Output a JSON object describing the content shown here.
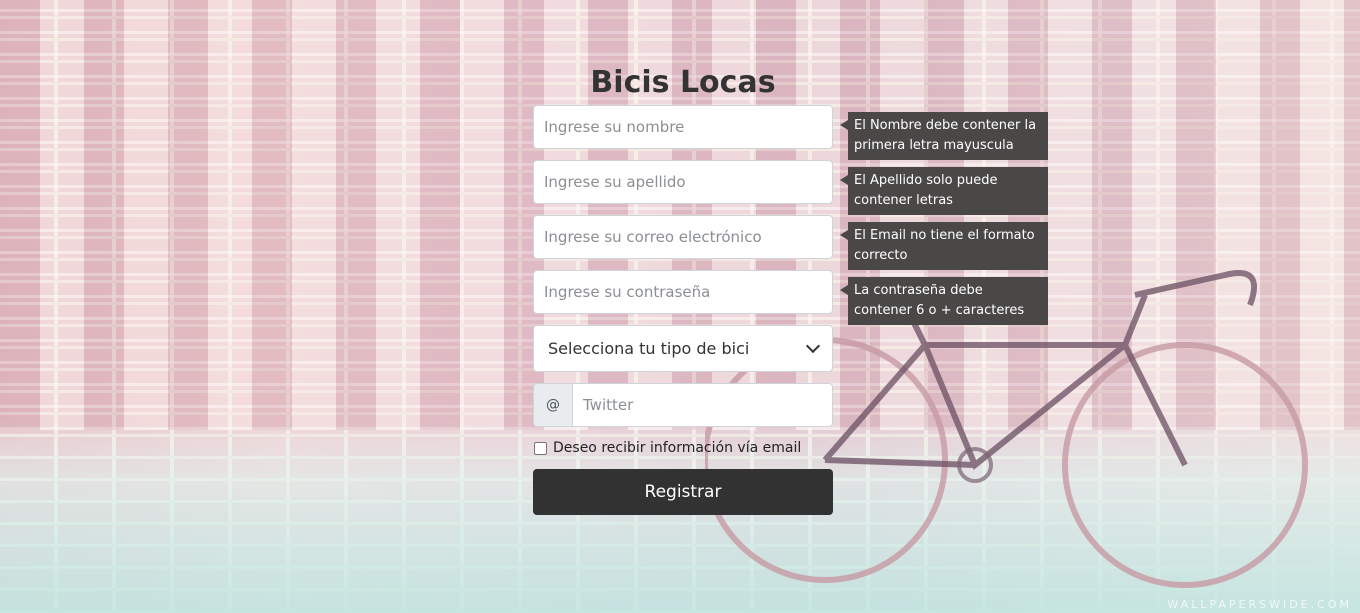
{
  "page": {
    "title": "Bicis Locas",
    "watermark": "WALLPAPERSWIDE.COM"
  },
  "form": {
    "fields": [
      {
        "placeholder": "Ingrese su nombre",
        "hint": "El Nombre debe contener la primera letra mayuscula"
      },
      {
        "placeholder": "Ingrese su apellido",
        "hint": "El Apellido solo puede contener letras"
      },
      {
        "placeholder": "Ingrese su correo electrónico",
        "hint": "El Email no tiene el formato correcto"
      },
      {
        "placeholder": "Ingrese su contraseña",
        "hint": "La contraseña debe contener 6 o + caracteres"
      }
    ],
    "bike_select": {
      "selected": "Selecciona tu tipo de bici"
    },
    "twitter": {
      "prefix": "@",
      "placeholder": "Twitter"
    },
    "newsletter": {
      "label": "Deseo recibir información vía email",
      "checked": false
    },
    "submit_label": "Registrar"
  },
  "colors": {
    "button": "#333232",
    "tooltip": "#4a4747"
  }
}
